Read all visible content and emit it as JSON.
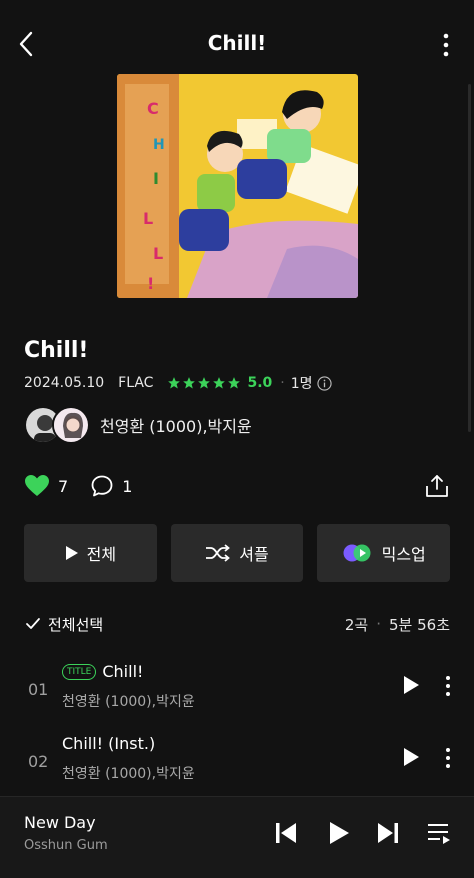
{
  "header": {
    "title": "Chill!",
    "back_icon": "chevron-left-icon",
    "more_icon": "more-vertical-icon"
  },
  "album": {
    "title": "Chill!",
    "release_date": "2024.05.10",
    "format": "FLAC",
    "rating": "5.0",
    "stars": 5,
    "rating_count": "1명",
    "artists": "천영환 (1000),박지윤",
    "likes": "7",
    "comments": "1"
  },
  "actions": {
    "play_all": "전체",
    "shuffle": "셔플",
    "mixup": "믹스업"
  },
  "tracklist": {
    "select_all": "전체선택",
    "song_count": "2곡",
    "total_duration": "5분 56초",
    "tracks": [
      {
        "number": "01",
        "title": "Chill!",
        "badge": "TITLE",
        "artist": "천영환 (1000),박지윤"
      },
      {
        "number": "02",
        "title": "Chill! (Inst.)",
        "badge": "",
        "artist": "천영환 (1000),박지윤"
      }
    ]
  },
  "now_playing": {
    "title": "New Day",
    "artist": "Osshun Gum"
  },
  "colors": {
    "background": "#121212",
    "accent_green": "#3cd35a",
    "button_bg": "#2a2a2a"
  }
}
